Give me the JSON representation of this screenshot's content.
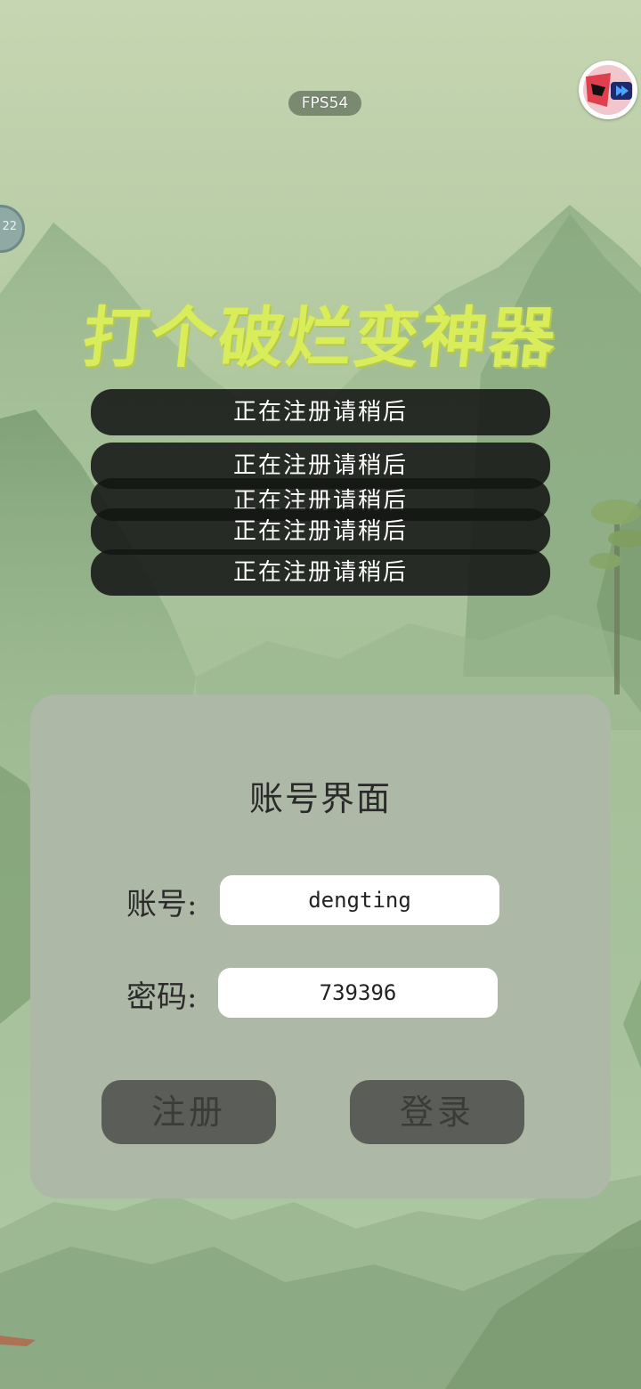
{
  "hud": {
    "fps_label": "FPS54",
    "side_badge": "22"
  },
  "app": {
    "title": "打个破烂变神器"
  },
  "toasts": [
    "正在注册请稍后",
    "正在注册请稍后",
    "正在注册请稍后",
    "正在注册请稍后",
    "正在注册请稍后"
  ],
  "account_panel": {
    "title": "账号界面",
    "account_label": "账号:",
    "account_value": "dengting",
    "password_label": "密码:",
    "password_value": "739396",
    "register_label": "注册",
    "login_label": "登录"
  },
  "icons": {
    "corner": "red-blue-play-badge-icon",
    "side": "floating-circle-icon"
  },
  "colors": {
    "title": "#d9ec5a",
    "panel": "#adb8a6",
    "button": "#5b5e58",
    "toast": "#141614"
  }
}
